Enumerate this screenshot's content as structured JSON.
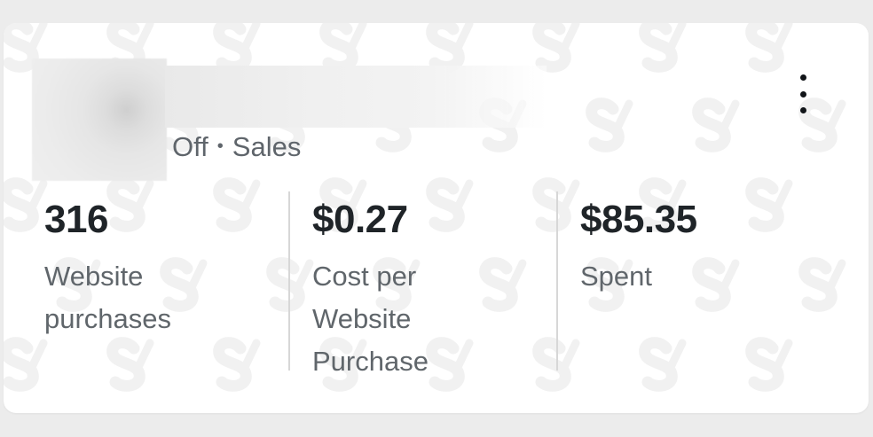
{
  "card": {
    "subtitle_status": "Off",
    "subtitle_separator": "•",
    "subtitle_objective": "Sales"
  },
  "metrics": [
    {
      "value": "316",
      "label": "Website\npurchases"
    },
    {
      "value": "$0.27",
      "label": "Cost per\nWebsite\nPurchase"
    },
    {
      "value": "$85.35",
      "label": "Spent"
    }
  ],
  "icons": {
    "menu": "more-vertical-icon",
    "watermark": "s-logo-watermark"
  },
  "colors": {
    "background": "#ececec",
    "card": "#ffffff",
    "primary_text": "#1f2428",
    "secondary_text": "#60666b",
    "divider": "#d7d7d7",
    "watermark": "#f1f1f1"
  }
}
